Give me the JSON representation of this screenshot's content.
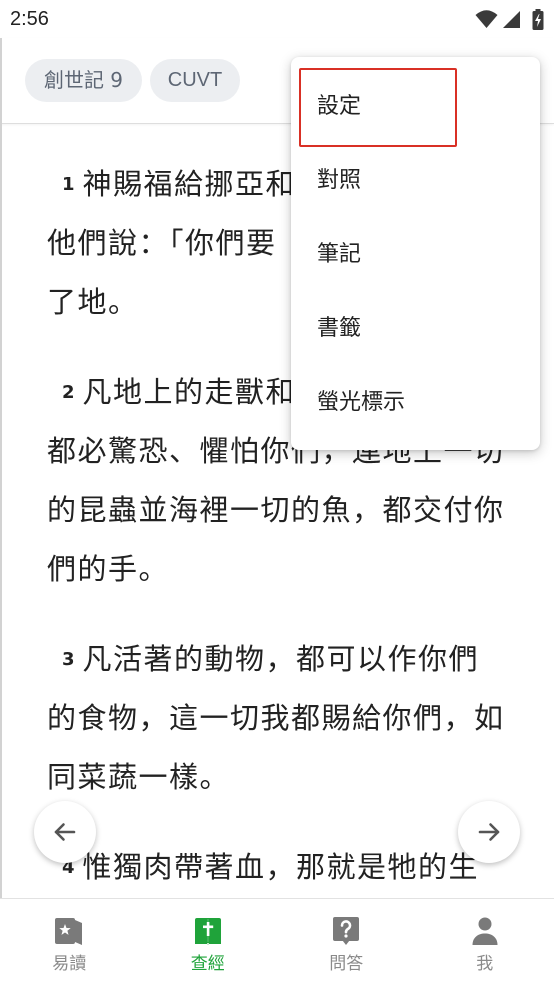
{
  "status_bar": {
    "time": "2:56",
    "icons": [
      "wifi-icon",
      "signal-icon",
      "battery-charging-icon"
    ]
  },
  "header": {
    "book_chip": "創世記 9",
    "version_chip": "CUVT"
  },
  "menu": {
    "items": [
      "設定",
      "對照",
      "筆記",
      "書籤",
      "螢光標示"
    ],
    "highlighted_index": 0
  },
  "content": {
    "verses": [
      {
        "num": "1",
        "lines": [
          "神賜福給挪亞和",
          "他們說：「你們要",
          "了地。"
        ]
      },
      {
        "num": "2",
        "lines": [
          "凡地上的走獸和",
          "都必驚恐、懼怕你們，連地上一切",
          "的昆蟲並海裡一切的魚，都交付你",
          "們的手。"
        ]
      },
      {
        "num": "3",
        "lines": [
          "凡活著的動物，都可以作你們",
          "的食物，這一切我都賜給你們，如",
          "同菜蔬一樣。"
        ]
      },
      {
        "num": "4",
        "lines": [
          "惟獨肉帶著血，那就是牠的生"
        ]
      }
    ]
  },
  "floating_nav": {
    "prev_icon": "arrow-left-icon",
    "next_icon": "arrow-right-icon"
  },
  "bottom_nav": {
    "items": [
      {
        "label": "易讀",
        "icon": "star-card-icon",
        "active": false
      },
      {
        "label": "查經",
        "icon": "bible-cross-icon",
        "active": true
      },
      {
        "label": "問答",
        "icon": "question-bubble-icon",
        "active": false
      },
      {
        "label": "我",
        "icon": "person-icon",
        "active": false
      }
    ]
  },
  "colors": {
    "accent": "#1fa33a",
    "highlight_border": "#d93025",
    "inactive": "#8a8a8a",
    "text": "#222222",
    "chip_bg": "#eceef1"
  }
}
